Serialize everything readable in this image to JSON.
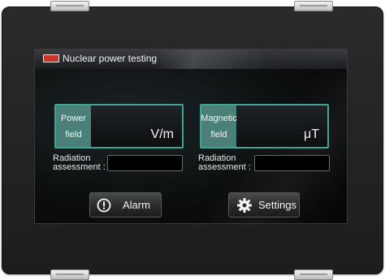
{
  "title": "Nuclear power testing",
  "panels": [
    {
      "label_line1": "Power",
      "label_line2": "field",
      "unit": "V/m"
    },
    {
      "label_line1": "Magnetic",
      "label_line2": "field",
      "unit": "μT"
    }
  ],
  "assessments": [
    {
      "label_line1": "Radiation",
      "label_line2": "assessment :",
      "value": ""
    },
    {
      "label_line1": "Radiation",
      "label_line2": "assessment :",
      "value": ""
    }
  ],
  "buttons": {
    "alarm_label": "Alarm",
    "alarm_icon": "alert-circle-icon",
    "settings_label": "Settings",
    "settings_icon": "gear-icon"
  },
  "colors": {
    "accent": "#3fa593",
    "label_fill": "#4a8077",
    "logo": "#c8342c"
  }
}
